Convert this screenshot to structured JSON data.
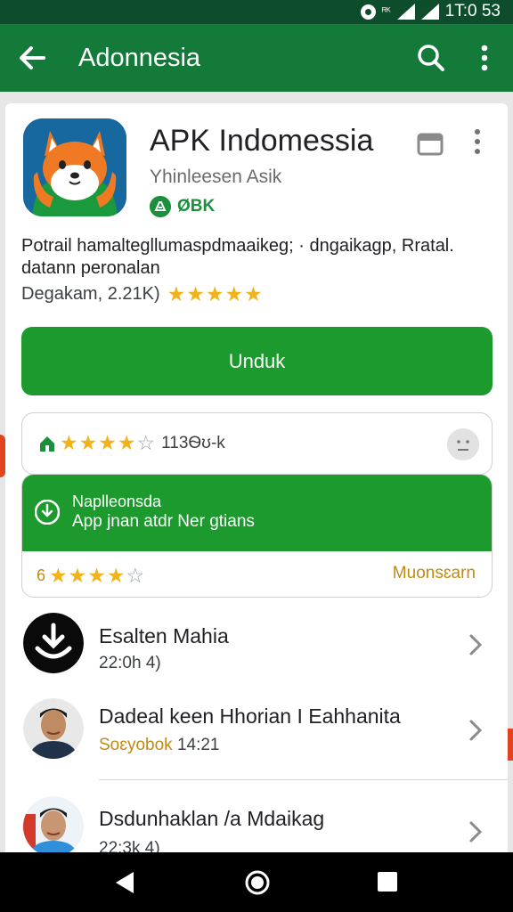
{
  "status_bar": {
    "time": "1T:0 53",
    "tiny": "ᴿᴷ"
  },
  "app_bar": {
    "title": "Adonnesia"
  },
  "app": {
    "name": "APK Indomessia",
    "developer": "Yhinleesen Asik",
    "badge": "ØBK",
    "description": "Potrail hamaltegllumaspdmaaikeg; · dngaikagp, Rratal. datann peronalan",
    "rating_text": "Degakam, 2.21K)",
    "rating": 4.5,
    "install_label": "Unduk"
  },
  "review_box": {
    "rating": 4,
    "count": "113Ѳʊ-k"
  },
  "promo": {
    "title": "Naplleonsda",
    "subtitle": "App jnan atdr Ner gtians",
    "rating_prefix": "6",
    "rating": 4,
    "link": "Muonsɛarn"
  },
  "list": [
    {
      "title": "Esalten Mahia",
      "subtitle": "22:0h 4)",
      "subtitle_prefix": ""
    },
    {
      "title": "Dadeal keen Hhorian I Eahhanita",
      "subtitle": "14:21",
      "subtitle_prefix": "Soɛyobok"
    },
    {
      "title": "Dsdunhaklan /a Mdaikag",
      "subtitle": "22:3k 4)",
      "subtitle_prefix": ""
    }
  ],
  "colors": {
    "status_bar": "#0e4d2b",
    "app_bar": "#137a3a",
    "accent_green": "#1c9a2e",
    "star": "#f2b21a",
    "gold_text": "#c28a12"
  }
}
